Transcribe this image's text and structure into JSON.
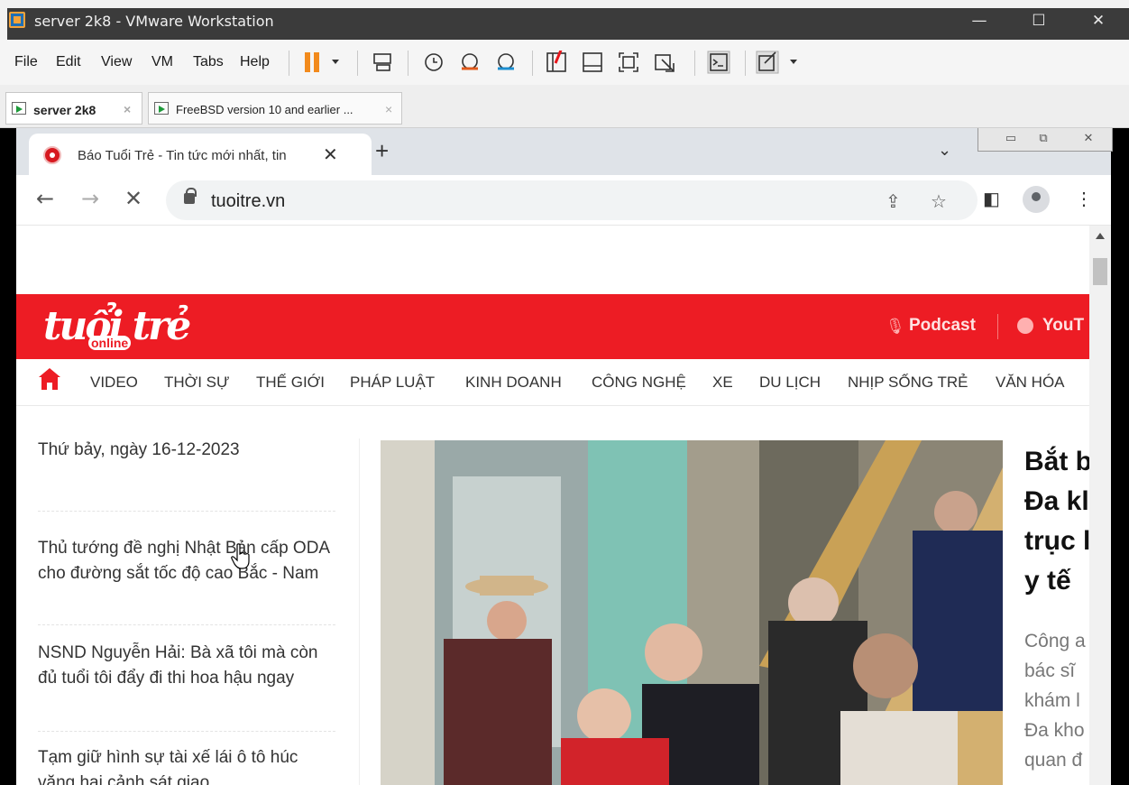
{
  "vm": {
    "title": "server 2k8 - VMware Workstation",
    "window_controls": {
      "minimize": "—",
      "maximize": "☐",
      "close": "✕"
    },
    "menu": [
      "File",
      "Edit",
      "View",
      "VM",
      "Tabs",
      "Help"
    ],
    "tabs": [
      {
        "label": "server 2k8",
        "close": "×",
        "active": true
      },
      {
        "label": "FreeBSD version 10 and earlier ...",
        "close": "×",
        "active": false
      }
    ]
  },
  "browser": {
    "tab_title": "Báo Tuổi Trẻ - Tin tức mới nhất, tin",
    "tab_close": "✕",
    "new_tab": "+",
    "tab_menu": "⌄",
    "win_controls": {
      "minimize": "▭",
      "restore": "⧉",
      "close": "✕"
    },
    "nav": {
      "back": "←",
      "forward": "→",
      "stop": "✕"
    },
    "url": "tuoitre.vn",
    "icons": {
      "share": "⇪",
      "star": "☆",
      "side_panel": "◧",
      "menu": "⋮"
    }
  },
  "site": {
    "logo": "tuổi trẻ",
    "logo_sub": "online",
    "header_links": {
      "podcast": "Podcast",
      "youtube": "YouT"
    },
    "nav_items": [
      "VIDEO",
      "THỜI SỰ",
      "THẾ GIỚI",
      "PHÁP LUẬT",
      "KINH DOANH",
      "CÔNG NGHỆ",
      "XE",
      "DU LỊCH",
      "NHỊP SỐNG TRẺ",
      "VĂN HÓA"
    ],
    "date": "Thứ bảy, ngày 16-12-2023",
    "sidebar_news": [
      "Thủ tướng đề nghị Nhật Bản cấp ODA cho đường sắt tốc độ cao Bắc - Nam",
      "NSND Nguyễn Hải: Bà xã tôi mà còn đủ tuổi tôi đẩy đi thi hoa hậu ngay",
      "Tạm giữ hình sự tài xế lái ô tô húc văng hai cảnh sát giao"
    ],
    "featured_title_lines": [
      "Bắt b",
      "Đa kl",
      "trục l",
      "y tế"
    ],
    "featured_summary_lines": [
      "Công a",
      "bác sĩ",
      "khám l",
      "Đa kho",
      "quan đ"
    ]
  },
  "colors": {
    "brand_red": "#ed1c24",
    "vm_titlebar": "#3b3b3b",
    "pause_orange": "#f28a1c"
  }
}
